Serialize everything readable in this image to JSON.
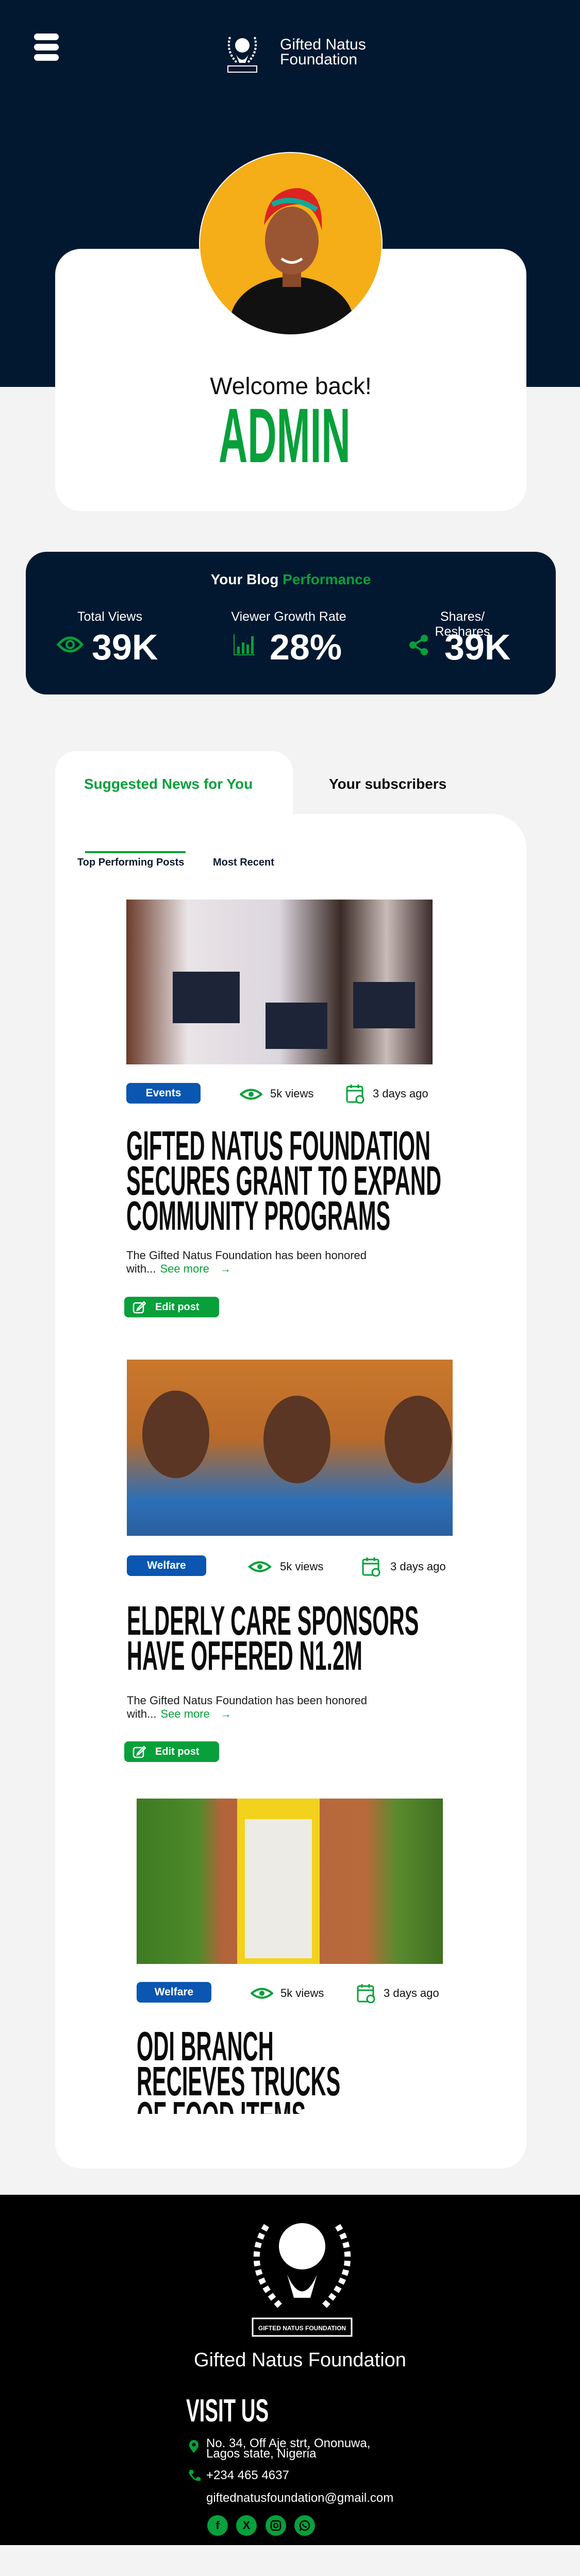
{
  "header": {
    "brand_line1": "Gifted Natus",
    "brand_line2": "Foundation"
  },
  "welcome": {
    "greeting": "Welcome back!",
    "name": "ADMIN"
  },
  "performance": {
    "title_part1": "Your Blog",
    "title_part2": "Performance",
    "stats": [
      {
        "label": "Total Views",
        "value": "39K",
        "icon": "eye-icon"
      },
      {
        "label": "Viewer Growth Rate",
        "value": "28%",
        "icon": "bar-chart-icon"
      },
      {
        "label": "Shares/ Reshares",
        "value": "39K",
        "icon": "share-icon"
      }
    ]
  },
  "tabs": {
    "active": "Suggested News for You",
    "other": "Your subscribers"
  },
  "subtabs": {
    "active": "Top Performing Posts",
    "other": "Most Recent"
  },
  "posts": [
    {
      "category": "Events",
      "views": "5k views",
      "time": "3 days ago",
      "title": "Gifted Natus Foundation Secures Grant to Expand Community Programs",
      "excerpt": "The Gifted Natus Foundation has been honored with...",
      "see_more": "See more",
      "edit": "Edit post"
    },
    {
      "category": "Welfare",
      "views": "5k views",
      "time": "3 days ago",
      "title": "Elderly Care Sponsors Have Offered N1.2M",
      "excerpt": "The Gifted Natus Foundation has been honored with...",
      "see_more": "See more",
      "edit": "Edit post"
    },
    {
      "category": "Welfare",
      "views": "5k views",
      "time": "3 days ago",
      "title": "Odi Branch Recieves Trucks of Food Items from Samaritans"
    }
  ],
  "footer": {
    "logo_text": "GIFTED NATUS FOUNDATION",
    "org_name": "Gifted Natus Foundation",
    "visit_title": "VISIT US",
    "address_line1": "No. 34, Off Aje strt, Ononuwa,",
    "address_line2": "Lagos state, Nigeria",
    "phone": "+234 465 4637",
    "email": "giftednatusfoundation@gmail.com",
    "social": [
      "facebook",
      "x",
      "instagram",
      "whatsapp"
    ]
  },
  "colors": {
    "navy": "#011830",
    "green": "#07a03a",
    "blue": "#0a56b0",
    "avatar_bg": "#f5ad18"
  }
}
